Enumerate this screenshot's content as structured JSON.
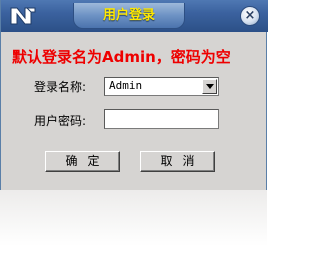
{
  "window": {
    "title": "用户登录",
    "close_glyph": "×"
  },
  "banner": "默认登录名为Admin，密码为空",
  "form": {
    "username_label": "登录名称:",
    "username_value": "Admin",
    "password_label": "用户密码:",
    "password_value": ""
  },
  "buttons": {
    "ok": "确定",
    "cancel": "取消"
  },
  "colors": {
    "title_text": "#ffe800",
    "banner_text": "#ee0000",
    "titlebar": "#3b629f",
    "window_bg": "#d6d4d2"
  },
  "icons": {
    "logo": "app-logo-icon",
    "close": "close-icon",
    "dropdown": "chevron-down-icon"
  }
}
